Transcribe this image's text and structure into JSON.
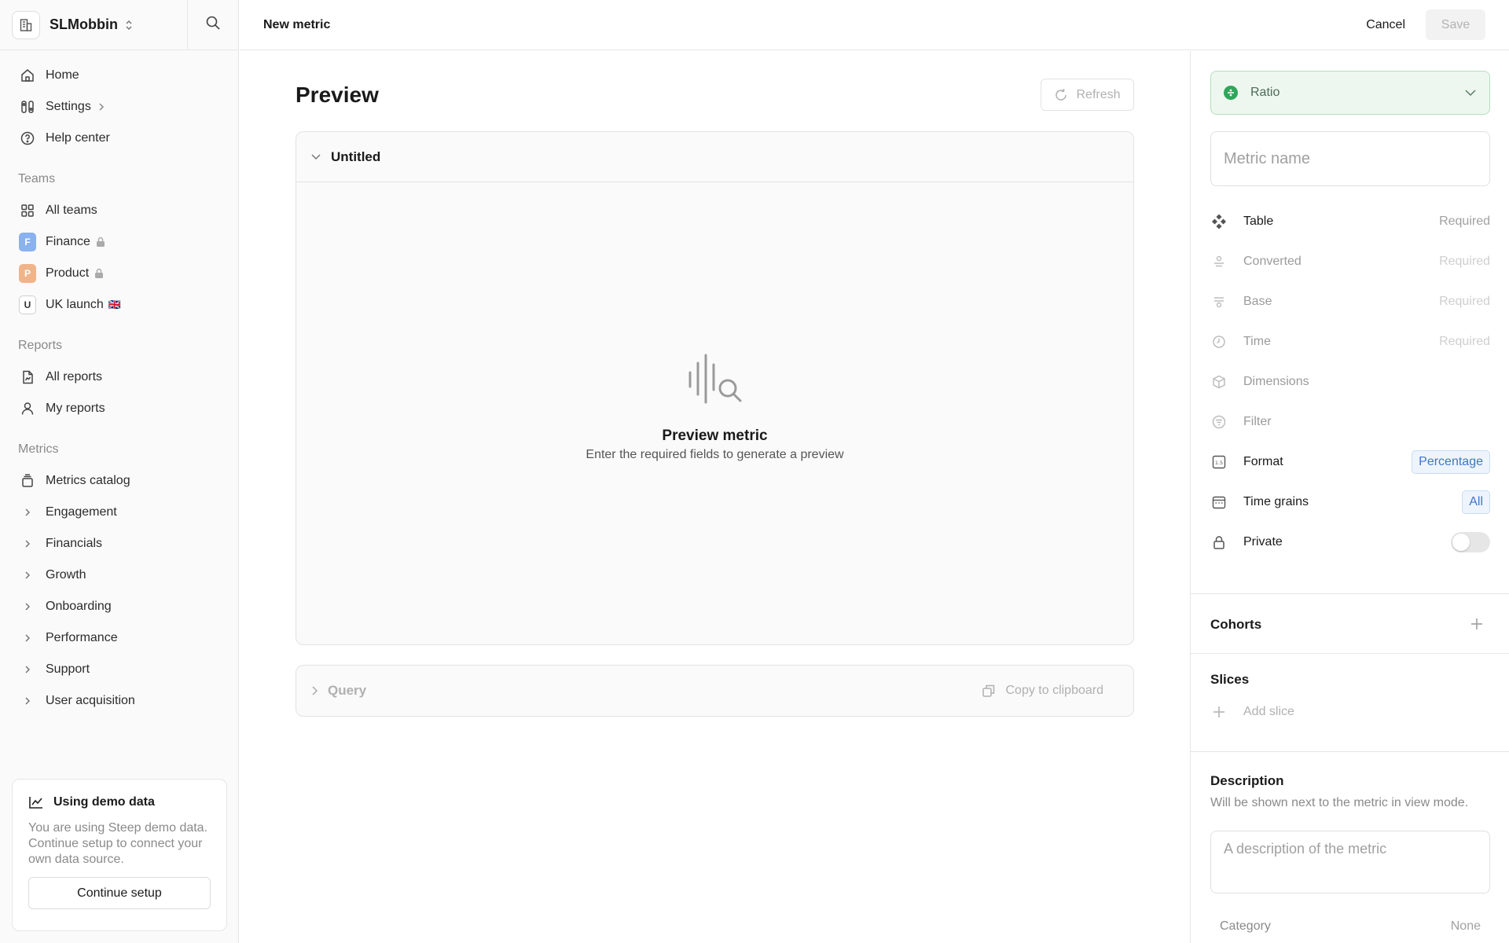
{
  "sidebar": {
    "workspace_name": "SLMobbin",
    "nav": [
      {
        "label": "Home"
      },
      {
        "label": "Settings"
      },
      {
        "label": "Help center"
      }
    ],
    "teams_heading": "Teams",
    "teams": [
      {
        "label": "All teams"
      },
      {
        "label": "Finance",
        "badge": "F",
        "badge_color": "#8ab1f0"
      },
      {
        "label": "Product",
        "badge": "P",
        "badge_color": "#f0b48a"
      },
      {
        "label": "UK launch",
        "badge": "U",
        "flag": "🇬🇧"
      }
    ],
    "reports_heading": "Reports",
    "reports": [
      {
        "label": "All reports"
      },
      {
        "label": "My reports"
      }
    ],
    "metrics_heading": "Metrics",
    "metrics": [
      {
        "label": "Metrics catalog"
      },
      {
        "label": "Engagement"
      },
      {
        "label": "Financials"
      },
      {
        "label": "Growth"
      },
      {
        "label": "Onboarding"
      },
      {
        "label": "Performance"
      },
      {
        "label": "Support"
      },
      {
        "label": "User acquisition"
      }
    ],
    "demo": {
      "title": "Using demo data",
      "text": "You are using Steep demo data. Continue setup to connect your own data source.",
      "button": "Continue setup"
    }
  },
  "header": {
    "title": "New metric",
    "cancel": "Cancel",
    "save": "Save"
  },
  "main": {
    "title": "Preview",
    "refresh": "Refresh",
    "card_title": "Untitled",
    "empty_title": "Preview metric",
    "empty_subtitle": "Enter the required fields to generate a preview",
    "query_label": "Query",
    "copy_label": "Copy to clipboard"
  },
  "panel": {
    "type": "Ratio",
    "name_placeholder": "Metric name",
    "props": [
      {
        "label": "Table",
        "value": "Required"
      },
      {
        "label": "Converted",
        "value": "Required"
      },
      {
        "label": "Base",
        "value": "Required"
      },
      {
        "label": "Time",
        "value": "Required"
      },
      {
        "label": "Dimensions"
      },
      {
        "label": "Filter"
      },
      {
        "label": "Format",
        "value": "Percentage"
      },
      {
        "label": "Time grains",
        "value": "All"
      },
      {
        "label": "Private"
      }
    ],
    "cohorts": "Cohorts",
    "slices": "Slices",
    "add_slice": "Add slice",
    "description_title": "Description",
    "description_sub": "Will be shown next to the metric in view mode.",
    "description_placeholder": "A description of the metric",
    "category_label": "Category",
    "category_value": "None"
  },
  "colors": {
    "accent_green": "#2fa65b",
    "chip_blue": "#3f77c4"
  }
}
